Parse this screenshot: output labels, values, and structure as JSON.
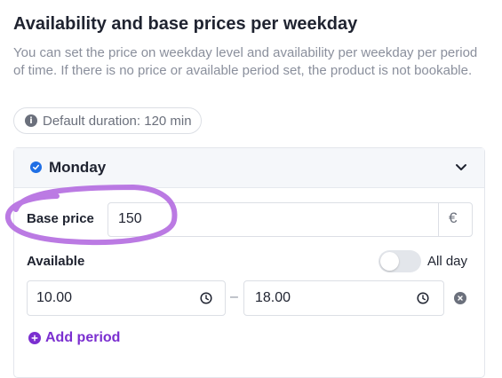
{
  "header": {
    "title": "Availability and base prices per weekday",
    "description": "You can set the price on weekday level and availability per weekday per period of time. If there is no price or available period set, the product is not bookable."
  },
  "duration_pill": {
    "label": "Default duration: 120 min",
    "icon": "info-icon"
  },
  "day_panel": {
    "day": "Monday",
    "checked": true,
    "expanded": true,
    "base_price": {
      "label": "Base price",
      "value": "150",
      "currency": "€"
    },
    "available": {
      "label": "Available",
      "all_day_label": "All day",
      "all_day_on": false
    },
    "period": {
      "from": "10.00",
      "separator": "–",
      "to": "18.00"
    },
    "add_period_label": "Add period"
  },
  "colors": {
    "accent": "#7b2fd0",
    "check": "#1f6fe5",
    "annotation": "#b46be0"
  }
}
